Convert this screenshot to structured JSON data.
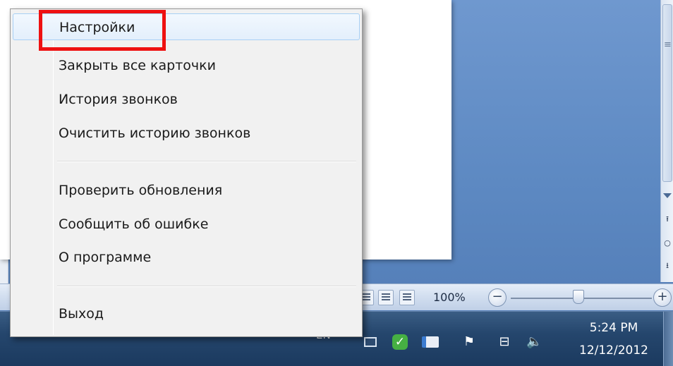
{
  "menu": {
    "items": [
      {
        "label": "Настройки"
      },
      {
        "label": "Закрыть все карточки"
      },
      {
        "label": "История звонков"
      },
      {
        "label": "Очистить историю звонков"
      },
      {
        "label": "Проверить обновления"
      },
      {
        "label": "Сообщить об ошибке"
      },
      {
        "label": "О программе"
      },
      {
        "label": "Выход"
      }
    ],
    "highlight_color": "#ee1111",
    "hover_color": "#a8d0f5"
  },
  "statusbar": {
    "zoom_label": "100%",
    "zoom_out": "−",
    "zoom_in": "+"
  },
  "taskbar": {
    "language": "EN",
    "time": "5:24 PM",
    "date": "12/12/2012"
  },
  "icons": {
    "tray": [
      "network-icon",
      "skype-icon",
      "card-icon",
      "flag-icon",
      "connection-icon",
      "volume-icon"
    ]
  }
}
